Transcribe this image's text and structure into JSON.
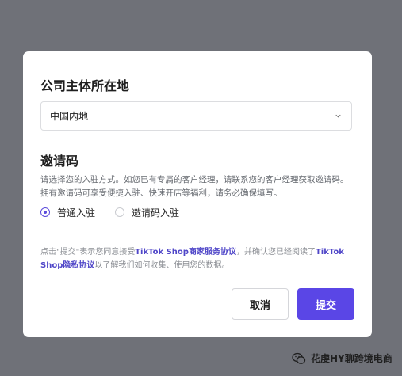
{
  "dialog": {
    "region_title": "公司主体所在地",
    "region_value": "中国内地",
    "invite_title": "邀请码",
    "invite_desc": "请选择您的入驻方式。如您已有专属的客户经理，请联系您的客户经理获取邀请码。拥有邀请码可享受便捷入驻、快速开店等福利，请务必确保填写。",
    "options": [
      {
        "label": "普通入驻",
        "checked": true
      },
      {
        "label": "邀请码入驻",
        "checked": false
      }
    ],
    "agreement": {
      "prefix": "点击\"提交\"表示您同意接受",
      "link1": "TikTok Shop商家服务协议",
      "middle": "，并确认您已经阅读了",
      "link2": "TikTok Shop隐私协议",
      "suffix": "以了解我们如何收集、使用您的数据。"
    },
    "cancel_label": "取消",
    "submit_label": "提交",
    "accent_color": "#5a46e6"
  },
  "watermark": {
    "icon": "wechat-icon",
    "text": "花虔HY聊跨境电商"
  }
}
